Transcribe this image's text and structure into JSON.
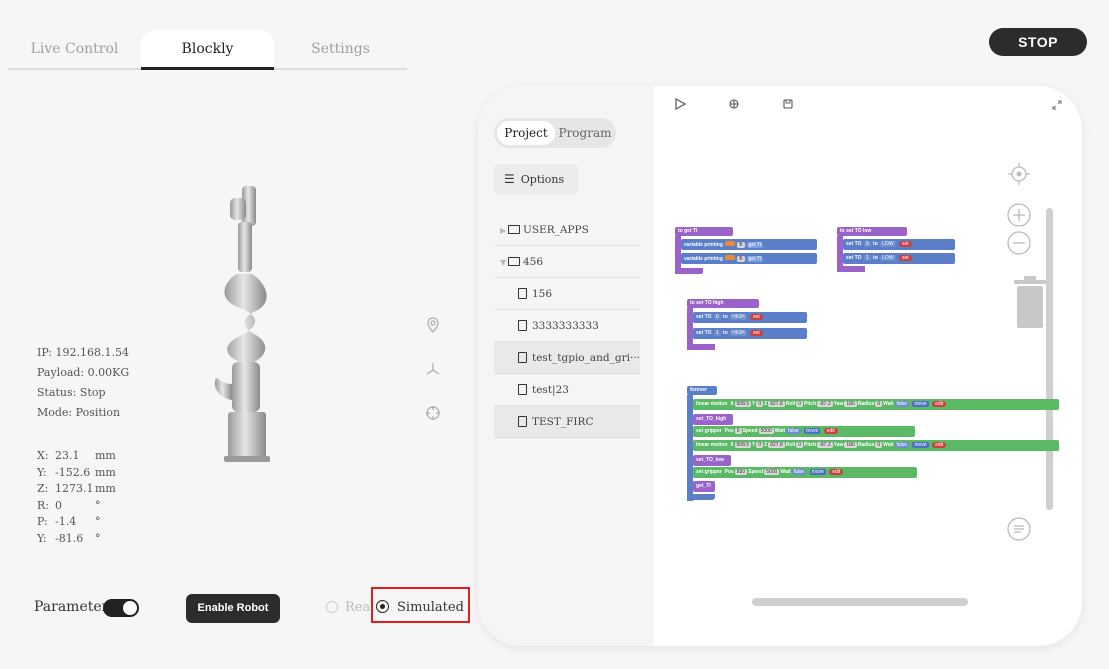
{
  "tabs": [
    {
      "label": "Live Control"
    },
    {
      "label": "Blockly"
    },
    {
      "label": "Settings"
    }
  ],
  "stop_label": "STOP",
  "status": {
    "ip": "IP: 192.168.1.54",
    "payload": "Payload: 0.00KG",
    "status": "Status: Stop",
    "mode": "Mode: Position"
  },
  "pose": [
    {
      "axis": "X:",
      "value": "23.1",
      "unit": "mm"
    },
    {
      "axis": "Y:",
      "value": "-152.6",
      "unit": "mm"
    },
    {
      "axis": "Z:",
      "value": "1273.1",
      "unit": "mm"
    },
    {
      "axis": "R:",
      "value": "0",
      "unit": "°"
    },
    {
      "axis": "P:",
      "value": "-1.4",
      "unit": "°"
    },
    {
      "axis": "Y:",
      "value": "-81.6",
      "unit": "°"
    }
  ],
  "controls": {
    "parameters_label": "Parameters",
    "enable_robot_label": "Enable Robot",
    "real_label": "Real",
    "simulated_label": "Simulated"
  },
  "file_panel": {
    "segment": [
      "Project",
      "Program"
    ],
    "options_label": "Options",
    "tree": [
      {
        "label": "USER_APPS",
        "kind": "folder"
      },
      {
        "label": "456",
        "kind": "folder"
      },
      {
        "label": "156",
        "kind": "file"
      },
      {
        "label": "3333333333",
        "kind": "file"
      },
      {
        "label": "test_tgpio_and_gri···",
        "kind": "file"
      },
      {
        "label": "test|23",
        "kind": "file"
      },
      {
        "label": "TEST_FIRC",
        "kind": "file"
      }
    ]
  },
  "blocks": {
    "get_ti": {
      "header": "to  get TI",
      "line1": "variable printing",
      "line2": "variable printing",
      "get_ti": "get TI"
    },
    "set_to_low": {
      "header": "to  set TO low",
      "line": "set TO",
      "to": "to",
      "low": "LOW",
      "set": "set"
    },
    "set_to_high": {
      "header": "to  set TO high",
      "line": "set TO",
      "to": "to",
      "high": "HIGH",
      "set": "set"
    },
    "forever": {
      "header": "forever",
      "linear": "linear motion",
      "x_lbl": "X",
      "x_val": "508.5",
      "y_lbl": "Y",
      "y_val": "0",
      "z_lbl": "Z",
      "z_val": "827.8",
      "roll_lbl": "Roll",
      "roll_val": "0",
      "pitch_lbl": "Pitch",
      "pitch_val": "-87.3",
      "yaw_lbl": "Yaw",
      "yaw_val": "180",
      "radius_lbl": "Radius",
      "radius_val": "0",
      "wait_lbl": "Wait",
      "wait_val": "false",
      "move": "move",
      "edit": "edit",
      "set_to_high": "set_TO_high",
      "set_to_low": "set_TO_low",
      "get_ti": "get_TI",
      "gripper": "set gripper",
      "pos_lbl": "Pos",
      "pos1": "0",
      "pos2": "850",
      "speed_lbl": "Speed",
      "speed_val": "5000",
      "edit2": "edit"
    }
  },
  "icons": {
    "play": "play-icon",
    "debug": "bug-icon",
    "save": "save-icon",
    "expand": "expand-icon",
    "locate": "locate-icon",
    "zoom_in": "zoom-in-icon",
    "zoom_out": "zoom-out-icon",
    "trash": "trash-icon",
    "menu": "menu-icon"
  },
  "colors": {
    "highlight": "#e02020",
    "button_dark": "#2c2c2c",
    "procedure": "#9a63c9",
    "motion": "#5bb865",
    "io": "#5b7ec9"
  }
}
